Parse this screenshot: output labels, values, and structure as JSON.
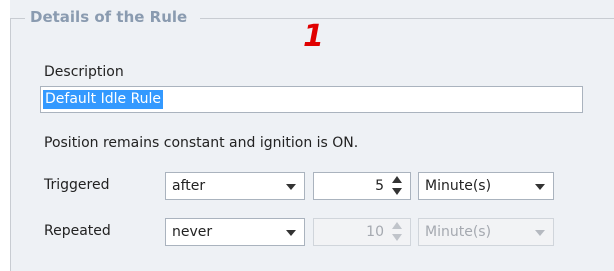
{
  "group": {
    "title": "Details of the Rule"
  },
  "annotation": "1",
  "description": {
    "label": "Description",
    "value": "Default Idle Rule"
  },
  "info_text": "Position remains constant and ignition is ON.",
  "triggered": {
    "label": "Triggered",
    "mode": "after",
    "amount": "5",
    "unit": "Minute(s)"
  },
  "repeated": {
    "label": "Repeated",
    "mode": "never",
    "amount": "10",
    "unit": "Minute(s)"
  },
  "colors": {
    "panel_bg": "#eef1f5",
    "selection": "#3399ff",
    "annotation": "#e00000",
    "legend": "#8a9bb0"
  },
  "icons": {
    "dropdown": "chevron-down-icon",
    "spin_up": "spin-up-icon",
    "spin_down": "spin-down-icon"
  }
}
